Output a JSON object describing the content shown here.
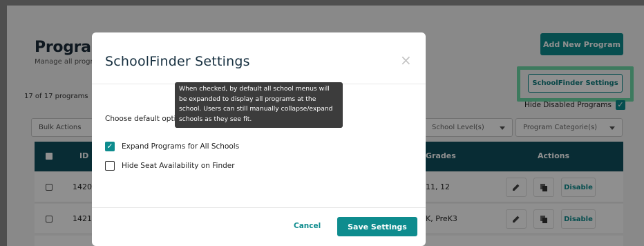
{
  "page": {
    "title": "Programs",
    "subtitle": "Manage all programs",
    "count": "17 of 17 programs",
    "add_button": "Add New Program",
    "sf_button": "SchoolFinder Settings",
    "hide_disabled": "Hide Disabled Programs",
    "bulk": "Bulk Actions",
    "filter_level": "School Level(s)",
    "filter_category": "Program Categorie(s)",
    "columns": {
      "id": "ID",
      "grades": "Grades",
      "actions": "Actions"
    },
    "rows": [
      {
        "id": "1420",
        "grades": "11, 12",
        "disable": "Disable"
      },
      {
        "id": "1421",
        "grades": "K, PreK3",
        "disable": "Disable"
      }
    ]
  },
  "modal": {
    "title": "SchoolFinder Settings",
    "choose": "Choose default options",
    "option_expand": "Expand Programs for All Schools",
    "option_expand_checked": true,
    "option_hide_seat": "Hide Seat Availability on Finder",
    "option_hide_seat_checked": false,
    "cancel": "Cancel",
    "save": "Save Settings"
  },
  "tooltip": {
    "text": "When checked, by default all school menus will be expanded to display all programs at the school. Users can still manually collapse/expand schools as they see fit."
  },
  "colors": {
    "teal": "#0e8c8e",
    "header": "#0f4f5e",
    "highlight": "#6ed9a8"
  }
}
